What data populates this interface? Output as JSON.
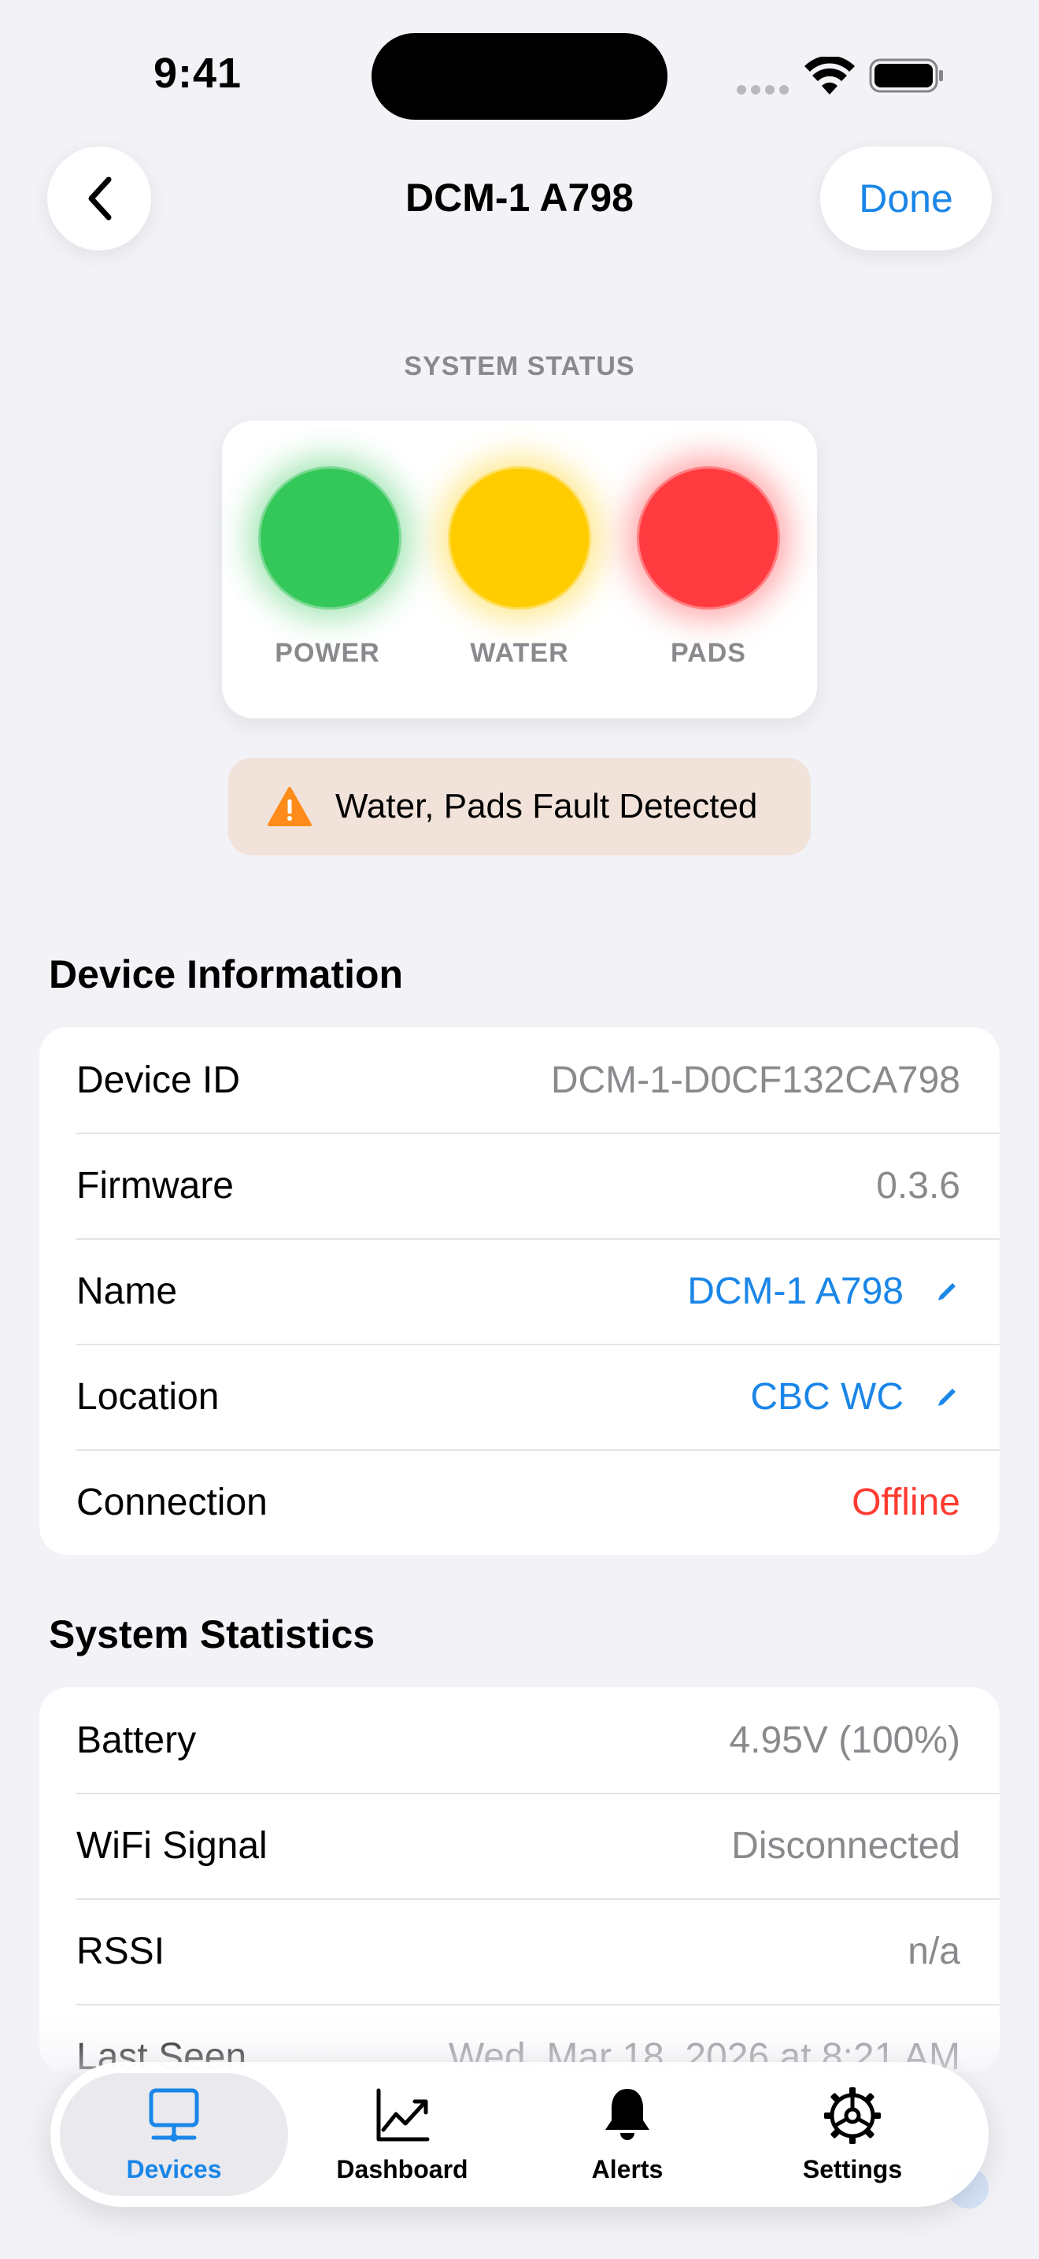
{
  "status_bar": {
    "time": "9:41"
  },
  "nav": {
    "title": "DCM-1 A798",
    "done_label": "Done",
    "back_icon": "chevron-left-icon"
  },
  "system_status": {
    "label": "SYSTEM STATUS",
    "lights": [
      {
        "label": "POWER",
        "color": "#34c759",
        "glow": "rgba(52,199,89,0.45)",
        "state": "ok"
      },
      {
        "label": "WATER",
        "color": "#ffcc00",
        "glow": "rgba(255,204,0,0.45)",
        "state": "warning"
      },
      {
        "label": "PADS",
        "color": "#ff3b40",
        "glow": "rgba(255,59,64,0.45)",
        "state": "fault"
      }
    ],
    "fault_message": "Water, Pads Fault Detected"
  },
  "device_info": {
    "title": "Device Information",
    "rows": [
      {
        "label": "Device ID",
        "value": "DCM-1-D0CF132CA798"
      },
      {
        "label": "Firmware",
        "value": "0.3.6"
      },
      {
        "label": "Name",
        "value": "DCM-1 A798"
      },
      {
        "label": "Location",
        "value": "CBC WC"
      },
      {
        "label": "Connection",
        "value": "Offline"
      }
    ]
  },
  "system_stats": {
    "title": "System Statistics",
    "rows": [
      {
        "label": "Battery",
        "value": "4.95V (100%)"
      },
      {
        "label": "WiFi Signal",
        "value": "Disconnected"
      },
      {
        "label": "RSSI",
        "value": "n/a"
      },
      {
        "label": "Last Seen",
        "value": "Wed, Mar 18, 2026 at 8:21 AM"
      }
    ]
  },
  "tabs": [
    {
      "label": "Devices",
      "icon": "devices-icon",
      "active": true
    },
    {
      "label": "Dashboard",
      "icon": "chart-icon",
      "active": false
    },
    {
      "label": "Alerts",
      "icon": "bell-icon",
      "active": false
    },
    {
      "label": "Settings",
      "icon": "gear-icon",
      "active": false
    }
  ],
  "colors": {
    "accent": "#1a86e8",
    "danger": "#ff3b30",
    "warning": "#ff8c1a",
    "background": "#f2f2f7"
  }
}
